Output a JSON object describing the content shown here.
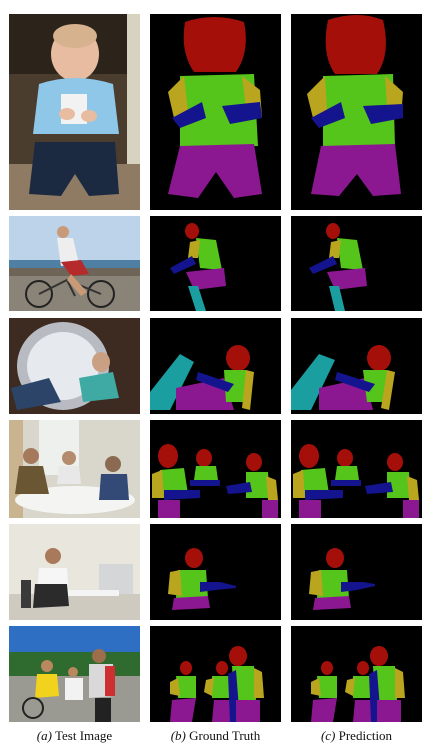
{
  "figure": {
    "captions": {
      "col1_tag": "(a)",
      "col1_text": "Test Image",
      "col2_tag": "(b)",
      "col2_text": "Ground Truth",
      "col3_tag": "(c)",
      "col3_text": "Prediction"
    },
    "part_colors": {
      "head": "#a50f0a",
      "torso": "#55c41b",
      "upper_arm": "#b9a51e",
      "lower_arm": "#14148f",
      "upper_leg": "#8c1891",
      "lower_leg": "#1a9ea0",
      "background": "#000000"
    },
    "rows": 6
  }
}
